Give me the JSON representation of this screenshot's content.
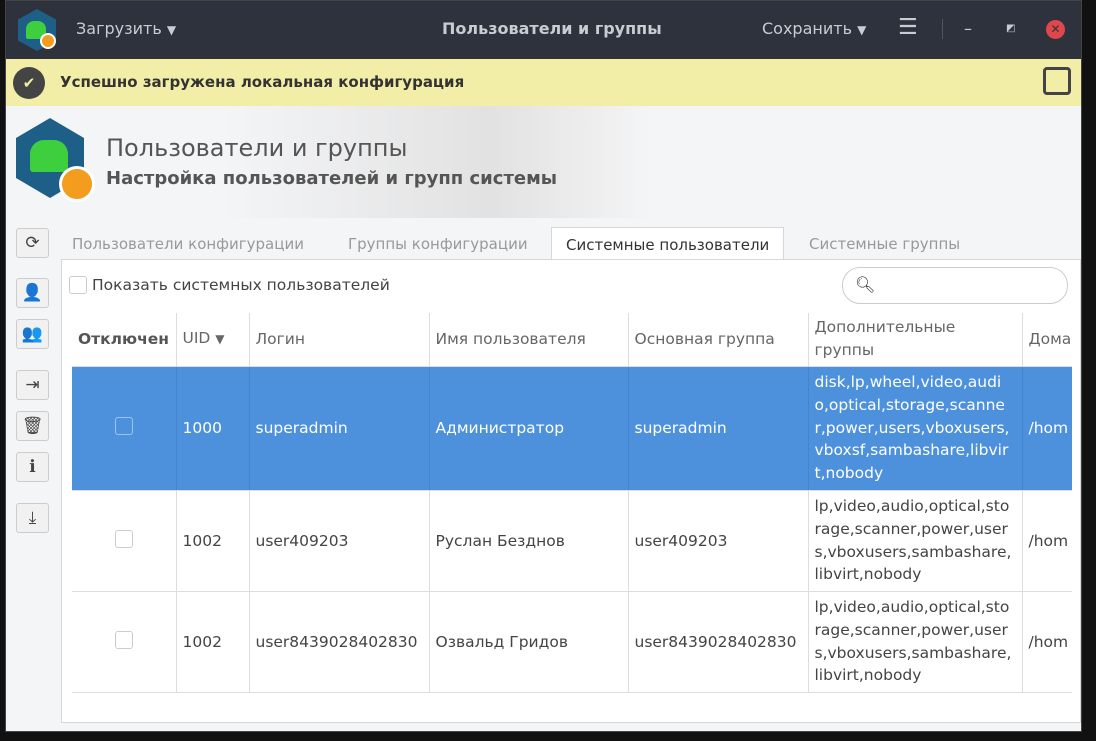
{
  "titlebar": {
    "title": "Пользователи и группы",
    "load": "Загрузить",
    "save": "Сохранить"
  },
  "notice": {
    "text": "Успешно загружена локальная конфигурация"
  },
  "header": {
    "title": "Пользователи и группы",
    "subtitle": "Настройка пользователей и групп системы"
  },
  "tabs": [
    "Пользователи конфигурации",
    "Группы конфигурации",
    "Системные пользователи",
    "Системные группы"
  ],
  "show_system": "Показать системных пользователей",
  "search": {
    "placeholder": ""
  },
  "columns": [
    "Отключен",
    "UID",
    "Логин",
    "Имя пользователя",
    "Основная группа",
    "Дополнительные группы",
    "Домашний каталог"
  ],
  "rows": [
    {
      "uid": "1000",
      "login": "superadmin",
      "name": "Администратор",
      "group": "superadmin",
      "extra": "disk,lp,wheel,video,audio,optical,storage,scanner,power,users,vboxusers,vboxsf,sambashare,libvirt,nobody",
      "home": "/hom"
    },
    {
      "uid": "1002",
      "login": "user409203",
      "name": "Руслан Безднов",
      "group": "user409203",
      "extra": "lp,video,audio,optical,storage,scanner,power,users,vboxusers,sambashare,libvirt,nobody",
      "home": "/hom"
    },
    {
      "uid": "1002",
      "login": "user8439028402830",
      "name": "Озвальд Гридов",
      "group": "user8439028402830",
      "extra": "lp,video,audio,optical,storage,scanner,power,users,vboxusers,sambashare,libvirt,nobody",
      "home": "/hom"
    }
  ]
}
